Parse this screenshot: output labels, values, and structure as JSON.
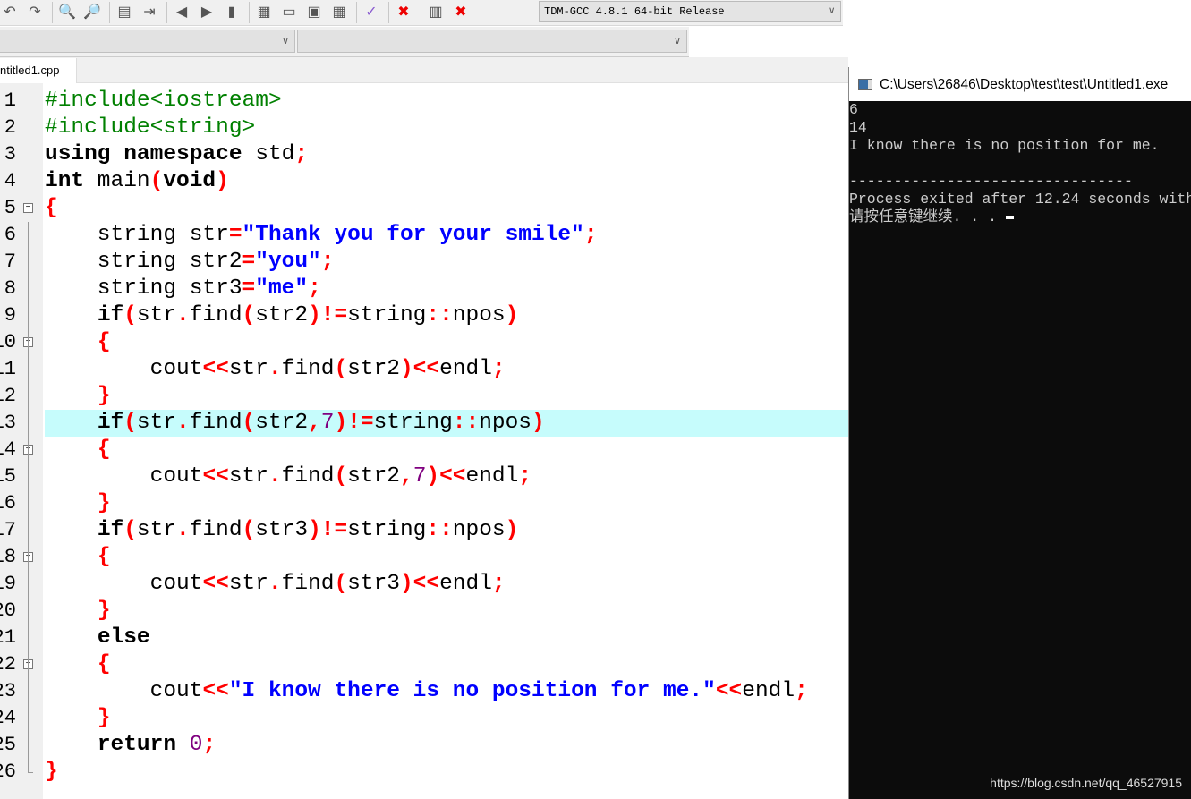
{
  "toolbar": {
    "compiler": "TDM-GCC 4.8.1 64-bit Release",
    "icons": [
      "undo-icon",
      "redo-icon",
      "find-icon",
      "replace-icon",
      "indent-icon",
      "unindent-icon",
      "bookmark-back-icon",
      "bookmark-forward-icon",
      "bookmark-icon",
      "new-project-icon",
      "window-icon",
      "options-icon",
      "view-icon",
      "check-syntax-icon",
      "delete-icon",
      "chart-icon",
      "debug-stop-icon"
    ]
  },
  "tab": {
    "label": "ntitled1.cpp"
  },
  "editor": {
    "highlighted_line": 13,
    "fold_lines": [
      5,
      10,
      14,
      18,
      22
    ],
    "guide_lines": [
      11,
      15,
      19,
      23
    ],
    "lines": [
      [
        [
          "#include<iostream>",
          "d"
        ]
      ],
      [
        [
          "#include<string>",
          "d"
        ]
      ],
      [
        [
          "using",
          "k"
        ],
        [
          " ",
          "t"
        ],
        [
          "namespace",
          "k"
        ],
        [
          " std",
          "t"
        ],
        [
          ";",
          "p"
        ]
      ],
      [
        [
          "int",
          "k"
        ],
        [
          " main",
          "t"
        ],
        [
          "(",
          "p"
        ],
        [
          "void",
          "k"
        ],
        [
          ")",
          "p"
        ]
      ],
      [
        [
          "{",
          "p"
        ]
      ],
      [
        [
          "    string str",
          "t"
        ],
        [
          "=",
          "p"
        ],
        [
          "\"Thank you for your smile\"",
          "s"
        ],
        [
          ";",
          "p"
        ]
      ],
      [
        [
          "    string str2",
          "t"
        ],
        [
          "=",
          "p"
        ],
        [
          "\"you\"",
          "s"
        ],
        [
          ";",
          "p"
        ]
      ],
      [
        [
          "    string str3",
          "t"
        ],
        [
          "=",
          "p"
        ],
        [
          "\"me\"",
          "s"
        ],
        [
          ";",
          "p"
        ]
      ],
      [
        [
          "    ",
          "t"
        ],
        [
          "if",
          "k"
        ],
        [
          "(",
          "p"
        ],
        [
          "str",
          "t"
        ],
        [
          ".",
          "p"
        ],
        [
          "find",
          "t"
        ],
        [
          "(",
          "p"
        ],
        [
          "str2",
          "t"
        ],
        [
          ")!=",
          "p"
        ],
        [
          "string",
          "t"
        ],
        [
          "::",
          "p"
        ],
        [
          "npos",
          "t"
        ],
        [
          ")",
          "p"
        ]
      ],
      [
        [
          "    ",
          "t"
        ],
        [
          "{",
          "p"
        ]
      ],
      [
        [
          "        cout",
          "t"
        ],
        [
          "<<",
          "p"
        ],
        [
          "str",
          "t"
        ],
        [
          ".",
          "p"
        ],
        [
          "find",
          "t"
        ],
        [
          "(",
          "p"
        ],
        [
          "str2",
          "t"
        ],
        [
          ")<<",
          "p"
        ],
        [
          "endl",
          "t"
        ],
        [
          ";",
          "p"
        ]
      ],
      [
        [
          "    ",
          "t"
        ],
        [
          "}",
          "p"
        ]
      ],
      [
        [
          "    ",
          "t"
        ],
        [
          "if",
          "k"
        ],
        [
          "(",
          "p"
        ],
        [
          "str",
          "t"
        ],
        [
          ".",
          "p"
        ],
        [
          "find",
          "t"
        ],
        [
          "(",
          "p"
        ],
        [
          "str2",
          "t"
        ],
        [
          ",",
          "p"
        ],
        [
          "7",
          "n"
        ],
        [
          ")!=",
          "p"
        ],
        [
          "string",
          "t"
        ],
        [
          "::",
          "p"
        ],
        [
          "npos",
          "t"
        ],
        [
          ")",
          "p"
        ]
      ],
      [
        [
          "    ",
          "t"
        ],
        [
          "{",
          "p"
        ]
      ],
      [
        [
          "        cout",
          "t"
        ],
        [
          "<<",
          "p"
        ],
        [
          "str",
          "t"
        ],
        [
          ".",
          "p"
        ],
        [
          "find",
          "t"
        ],
        [
          "(",
          "p"
        ],
        [
          "str2",
          "t"
        ],
        [
          ",",
          "p"
        ],
        [
          "7",
          "n"
        ],
        [
          ")<<",
          "p"
        ],
        [
          "endl",
          "t"
        ],
        [
          ";",
          "p"
        ]
      ],
      [
        [
          "    ",
          "t"
        ],
        [
          "}",
          "p"
        ]
      ],
      [
        [
          "    ",
          "t"
        ],
        [
          "if",
          "k"
        ],
        [
          "(",
          "p"
        ],
        [
          "str",
          "t"
        ],
        [
          ".",
          "p"
        ],
        [
          "find",
          "t"
        ],
        [
          "(",
          "p"
        ],
        [
          "str3",
          "t"
        ],
        [
          ")!=",
          "p"
        ],
        [
          "string",
          "t"
        ],
        [
          "::",
          "p"
        ],
        [
          "npos",
          "t"
        ],
        [
          ")",
          "p"
        ]
      ],
      [
        [
          "    ",
          "t"
        ],
        [
          "{",
          "p"
        ]
      ],
      [
        [
          "        cout",
          "t"
        ],
        [
          "<<",
          "p"
        ],
        [
          "str",
          "t"
        ],
        [
          ".",
          "p"
        ],
        [
          "find",
          "t"
        ],
        [
          "(",
          "p"
        ],
        [
          "str3",
          "t"
        ],
        [
          ")<<",
          "p"
        ],
        [
          "endl",
          "t"
        ],
        [
          ";",
          "p"
        ]
      ],
      [
        [
          "    ",
          "t"
        ],
        [
          "}",
          "p"
        ]
      ],
      [
        [
          "    ",
          "t"
        ],
        [
          "else",
          "k"
        ]
      ],
      [
        [
          "    ",
          "t"
        ],
        [
          "{",
          "p"
        ]
      ],
      [
        [
          "        cout",
          "t"
        ],
        [
          "<<",
          "p"
        ],
        [
          "\"I know there is no position for me.\"",
          "s"
        ],
        [
          "<<",
          "p"
        ],
        [
          "endl",
          "t"
        ],
        [
          ";",
          "p"
        ]
      ],
      [
        [
          "    ",
          "t"
        ],
        [
          "}",
          "p"
        ]
      ],
      [
        [
          "    ",
          "t"
        ],
        [
          "return",
          "k"
        ],
        [
          " ",
          "t"
        ],
        [
          "0",
          "n"
        ],
        [
          ";",
          "p"
        ]
      ],
      [
        [
          "}",
          "p"
        ]
      ]
    ]
  },
  "console": {
    "title": "C:\\Users\\26846\\Desktop\\test\\test\\Untitled1.exe",
    "lines": [
      "6",
      "14",
      "I know there is no position for me.",
      "",
      "--------------------------------",
      "Process exited after 12.24 seconds with",
      "请按任意键继续. . . "
    ]
  },
  "watermark": "https://blog.csdn.net/qq_46527915"
}
